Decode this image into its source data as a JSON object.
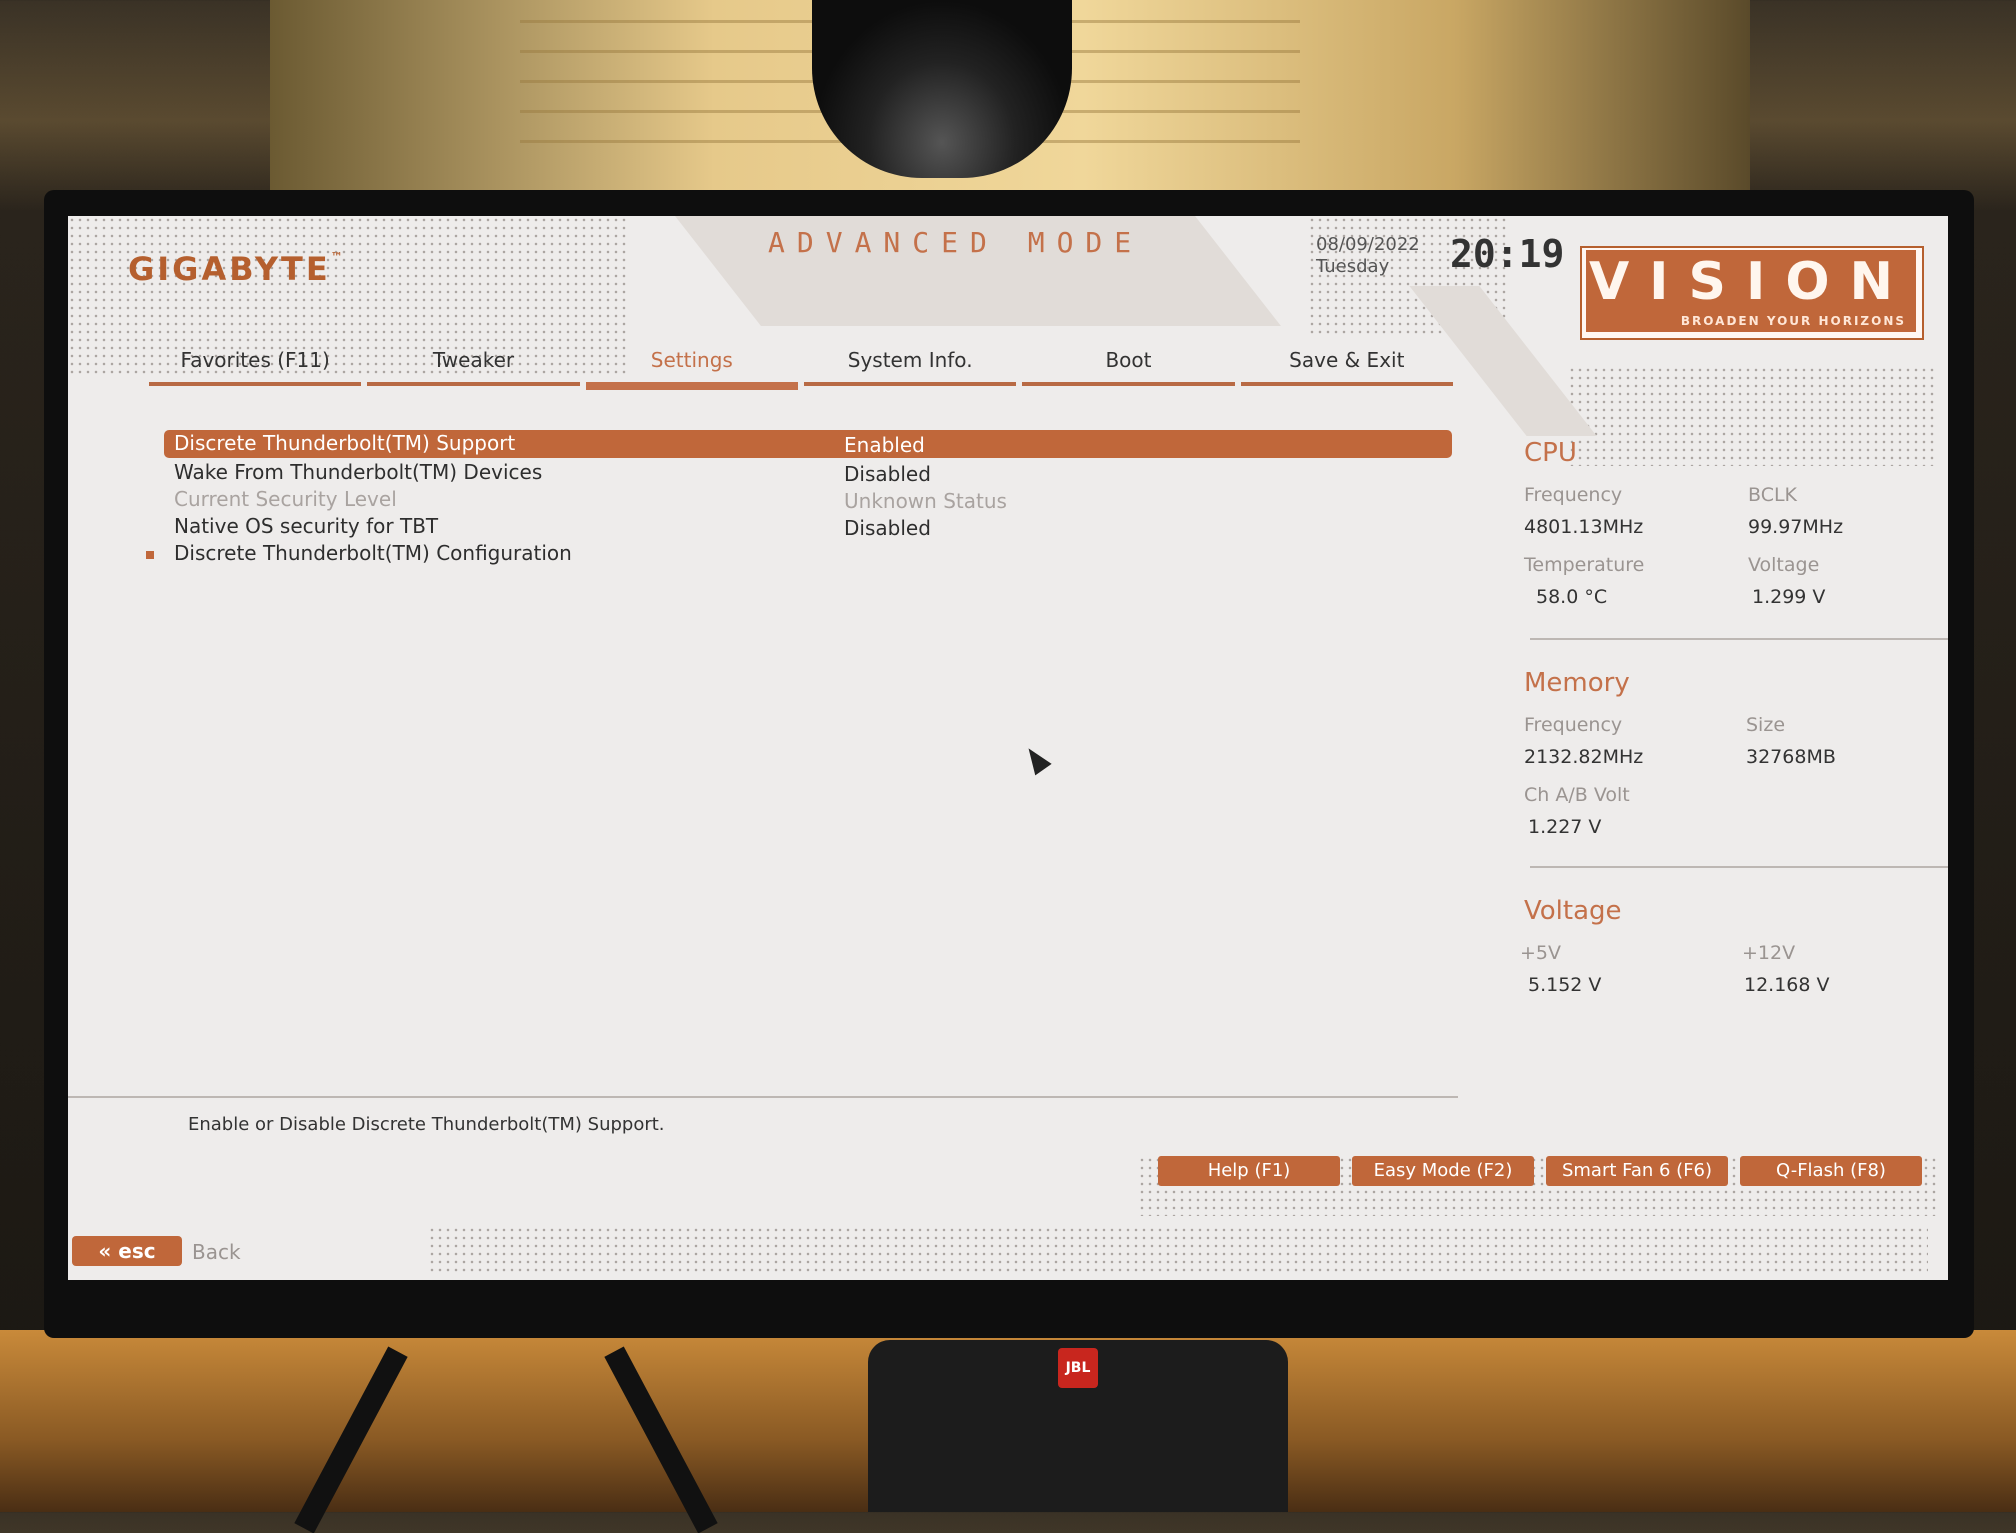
{
  "header": {
    "brand": "GIGABYTE",
    "brand_tm": "™",
    "mode_title": "ADVANCED MODE",
    "date": "08/09/2022",
    "weekday": "Tuesday",
    "time": "20:19",
    "logo_word": "VISION",
    "logo_tagline": "BROADEN YOUR HORIZONS"
  },
  "tabs": [
    {
      "label": "Favorites (F11)"
    },
    {
      "label": "Tweaker"
    },
    {
      "label": "Settings"
    },
    {
      "label": "System Info."
    },
    {
      "label": "Boot"
    },
    {
      "label": "Save & Exit"
    }
  ],
  "active_tab": "Settings",
  "settings": [
    {
      "label": "Discrete Thunderbolt(TM) Support",
      "value": "Enabled"
    },
    {
      "label": "Wake From Thunderbolt(TM) Devices",
      "value": "Disabled"
    },
    {
      "label": "Current Security Level",
      "value": "Unknown Status"
    },
    {
      "label": "Native OS security for TBT",
      "value": "Disabled"
    },
    {
      "label": "Discrete Thunderbolt(TM) Configuration",
      "value": ""
    }
  ],
  "panel": {
    "cpu": {
      "title": "CPU",
      "frequency_label": "Frequency",
      "frequency": "4801.13MHz",
      "bclk_label": "BCLK",
      "bclk": "99.97MHz",
      "temperature_label": "Temperature",
      "temperature": "58.0 °C",
      "voltage_label": "Voltage",
      "voltage": "1.299 V"
    },
    "memory": {
      "title": "Memory",
      "frequency_label": "Frequency",
      "frequency": "2132.82MHz",
      "size_label": "Size",
      "size": "32768MB",
      "volt_label": "Ch A/B Volt",
      "volt": "1.227 V"
    },
    "voltage": {
      "title": "Voltage",
      "v5_label": "+5V",
      "v5": "5.152 V",
      "v12_label": "+12V",
      "v12": "12.168 V"
    }
  },
  "help_text": "Enable or Disable Discrete Thunderbolt(TM) Support.",
  "function_buttons": [
    {
      "label": "Help (F1)"
    },
    {
      "label": "Easy Mode (F2)"
    },
    {
      "label": "Smart Fan 6 (F6)"
    },
    {
      "label": "Q-Flash (F8)"
    }
  ],
  "esc": {
    "key": "esc",
    "label": "Back"
  },
  "colors": {
    "accent": "#c0673a",
    "screen_bg": "#eeeceb"
  },
  "environment": {
    "speaker_brand": "JBL"
  }
}
